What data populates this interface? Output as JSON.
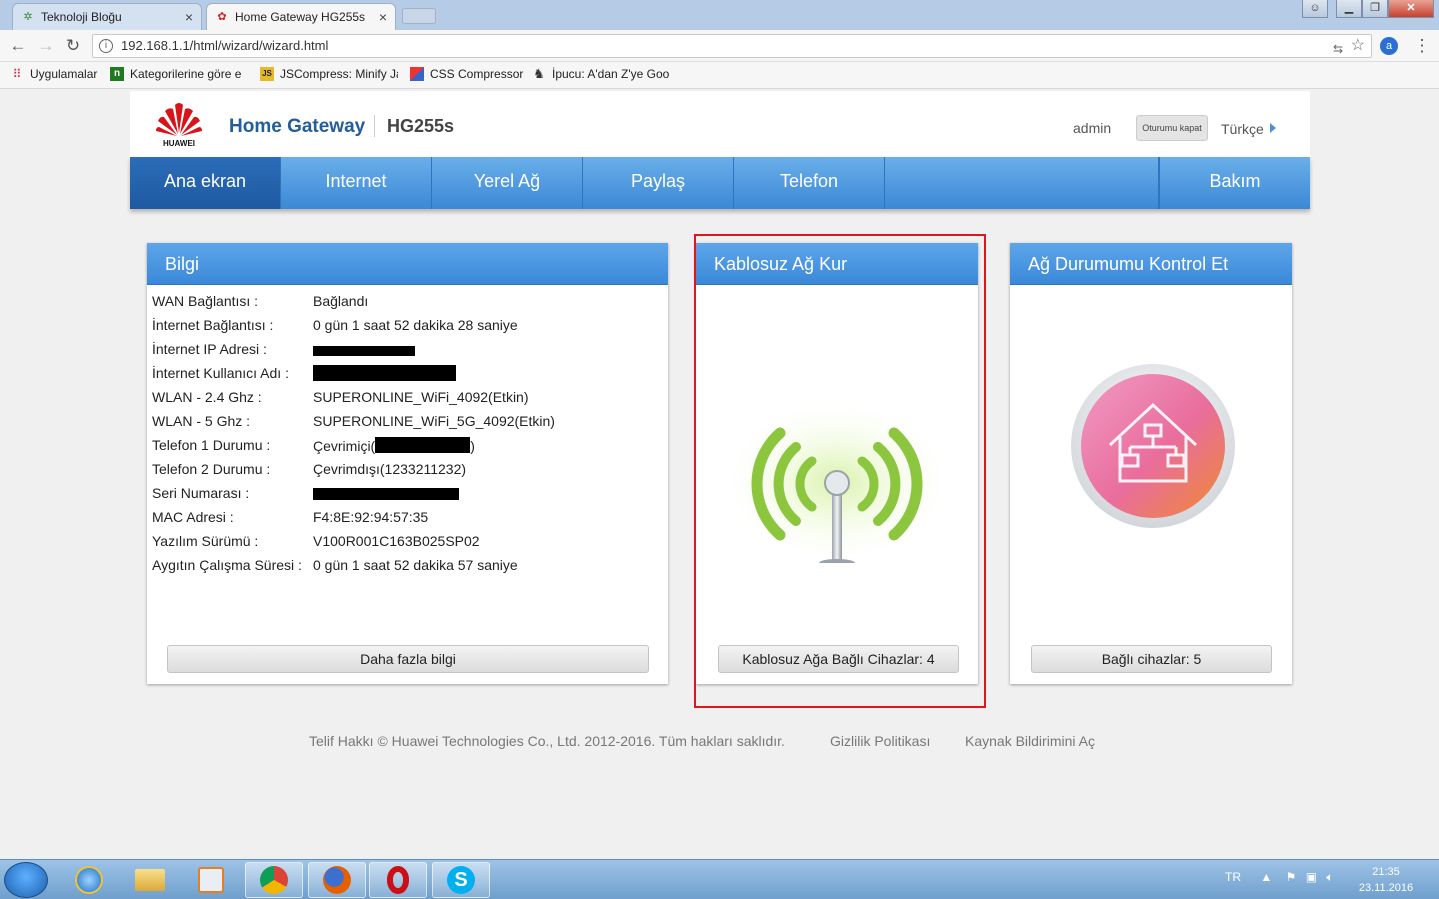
{
  "browser": {
    "tabs": [
      {
        "label": "Teknoloji Bloğu",
        "active": false
      },
      {
        "label": "Home Gateway HG255s",
        "active": true
      }
    ],
    "tab_close": "×",
    "url": "192.168.1.1/html/wizard/wizard.html",
    "bookmarks": [
      {
        "label": "Uygulamalar",
        "icon": "apps-icon"
      },
      {
        "label": "Kategorilerine göre e",
        "icon": "n-icon"
      },
      {
        "label": "JSCompress: Minify Ja",
        "icon": "js-icon"
      },
      {
        "label": "CSS Compressor",
        "icon": "css-icon"
      },
      {
        "label": "İpucu: A'dan Z'ye Goo",
        "icon": "ipucu-icon"
      }
    ]
  },
  "header": {
    "logo_text": "HUAWEI",
    "brand": "Home Gateway",
    "model": "HG255s",
    "user": "admin",
    "logout": "Oturumu kapat",
    "language": "Türkçe"
  },
  "nav": [
    {
      "label": "Ana ekran",
      "active": true
    },
    {
      "label": "Internet",
      "active": false
    },
    {
      "label": "Yerel Ağ",
      "active": false
    },
    {
      "label": "Paylaş",
      "active": false
    },
    {
      "label": "Telefon",
      "active": false
    },
    {
      "label": "",
      "active": false
    },
    {
      "label": "Bakım",
      "active": false
    }
  ],
  "info": {
    "title": "Bilgi",
    "rows": [
      {
        "key": "WAN Bağlantısı :",
        "value": "Bağlandı"
      },
      {
        "key": "İnternet Bağlantısı :",
        "value": "0 gün 1 saat 52 dakika 28 saniye"
      },
      {
        "key": "İnternet IP Adresi :",
        "value": ""
      },
      {
        "key": "İnternet Kullanıcı Adı :",
        "value": ""
      },
      {
        "key": "WLAN - 2.4 Ghz :",
        "value": "SUPERONLINE_WiFi_4092(Etkin)"
      },
      {
        "key": "WLAN - 5 Ghz :",
        "value": "SUPERONLINE_WiFi_5G_4092(Etkin)"
      },
      {
        "key": "Telefon 1 Durumu :",
        "value": "Çevrimiçi(",
        "suffix": ")"
      },
      {
        "key": "Telefon 2 Durumu :",
        "value": "Çevrimdışı(1233211232)"
      },
      {
        "key": "Seri Numarası :",
        "value": ""
      },
      {
        "key": "MAC Adresi :",
        "value": "F4:8E:92:94:57:35"
      },
      {
        "key": "Yazılım Sürümü :",
        "value": "V100R001C163B025SP02"
      },
      {
        "key": "Aygıtın Çalışma Süresi :",
        "value": "0 gün 1 saat 52 dakika 57 saniye"
      }
    ],
    "button": "Daha fazla bilgi"
  },
  "wifi": {
    "title": "Kablosuz Ağ Kur",
    "button": "Kablosuz Ağa Bağlı Cihazlar: 4"
  },
  "network": {
    "title": "Ağ Durumumu Kontrol Et",
    "button": "Bağlı cihazlar: 5"
  },
  "footer": {
    "copyright": "Telif Hakkı © Huawei Technologies Co., Ltd. 2012-2016. Tüm hakları saklıdır.",
    "privacy": "Gizlilik Politikası",
    "opensource": "Kaynak Bildirimini Aç"
  },
  "taskbar": {
    "lang": "TR",
    "time": "21:35",
    "date": "23.11.2016"
  },
  "colors": {
    "accent": "#3b88d6",
    "highlight": "#e0161e",
    "brand": "#245d99"
  }
}
